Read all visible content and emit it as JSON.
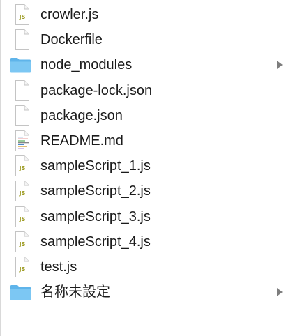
{
  "items": [
    {
      "name": "crowler.js",
      "kind": "js",
      "icon": "js-file-icon",
      "badge": "JS"
    },
    {
      "name": "Dockerfile",
      "kind": "doc",
      "icon": "document-icon"
    },
    {
      "name": "node_modules",
      "kind": "folder",
      "icon": "folder-icon",
      "expandable": true
    },
    {
      "name": "package-lock.json",
      "kind": "doc",
      "icon": "document-icon"
    },
    {
      "name": "package.json",
      "kind": "doc",
      "icon": "document-icon"
    },
    {
      "name": "README.md",
      "kind": "text",
      "icon": "text-file-icon"
    },
    {
      "name": "sampleScript_1.js",
      "kind": "js",
      "icon": "js-file-icon",
      "badge": "JS"
    },
    {
      "name": "sampleScript_2.js",
      "kind": "js",
      "icon": "js-file-icon",
      "badge": "JS"
    },
    {
      "name": "sampleScript_3.js",
      "kind": "js",
      "icon": "js-file-icon",
      "badge": "JS"
    },
    {
      "name": "sampleScript_4.js",
      "kind": "js",
      "icon": "js-file-icon",
      "badge": "JS"
    },
    {
      "name": "test.js",
      "kind": "js",
      "icon": "js-file-icon",
      "badge": "JS"
    },
    {
      "name": "名称未設定",
      "kind": "folder",
      "icon": "folder-icon",
      "expandable": true
    }
  ],
  "colors": {
    "folder": "#5fb4ea",
    "folder_tab": "#7cc7f3",
    "js_badge": "#9c9a1f",
    "text": "#1b1b1b",
    "page_stroke": "#c4c4c4",
    "chevron": "#7d7d7d"
  }
}
